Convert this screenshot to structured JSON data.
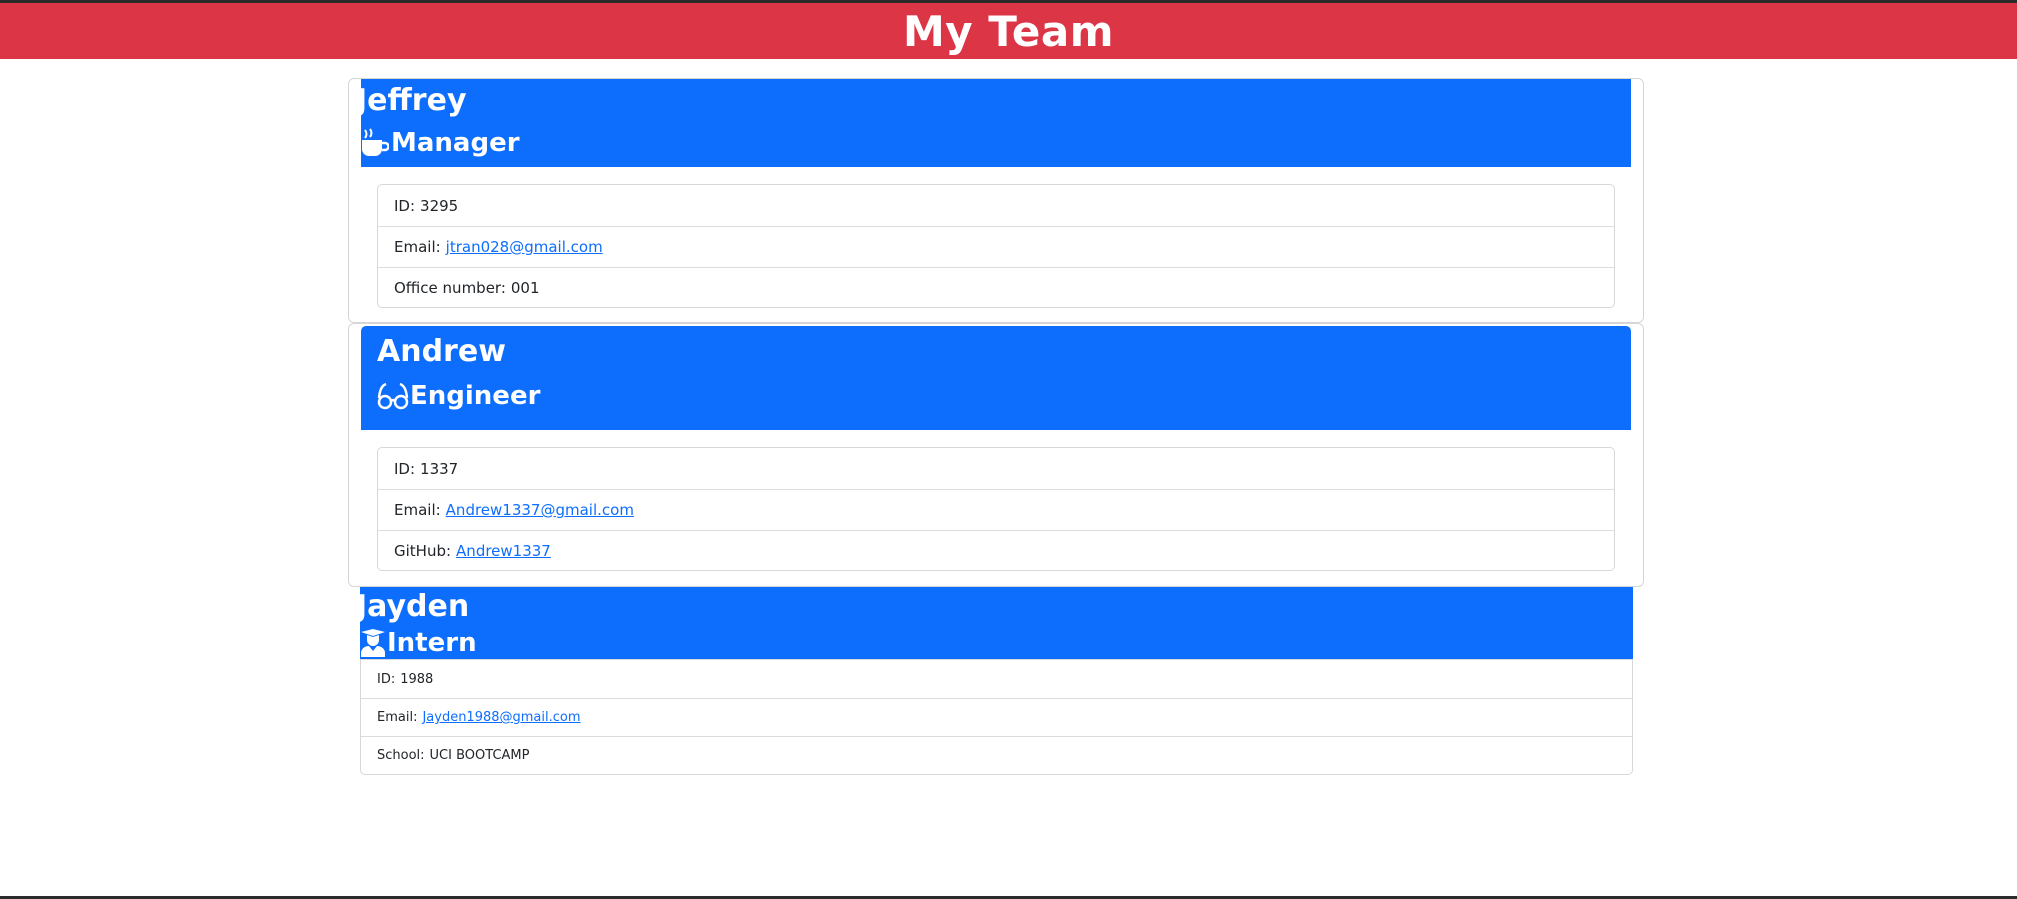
{
  "header": {
    "title": "My Team"
  },
  "team": [
    {
      "name": "Jeffrey",
      "role": "Manager",
      "role_icon": "mug-icon",
      "id_label": "ID:",
      "id": "3295",
      "email_label": "Email:",
      "email": "jtran028@gmail.com",
      "extra_label": "Office number:",
      "extra_value": "001"
    },
    {
      "name": "Andrew",
      "role": "Engineer",
      "role_icon": "glasses-icon",
      "id_label": "ID:",
      "id": "1337",
      "email_label": "Email:",
      "email": "Andrew1337@gmail.com",
      "extra_label": "GitHub:",
      "extra_value": "Andrew1337"
    },
    {
      "name": "Jayden",
      "role": "Intern",
      "role_icon": "graduate-icon",
      "id_label": "ID:",
      "id": "1988",
      "email_label": "Email:",
      "email": "Jayden1988@gmail.com",
      "extra_label": "School:",
      "extra_value": "UCI BOOTCAMP"
    }
  ],
  "colors": {
    "banner": "#dc3545",
    "card_header": "#0d6efd",
    "link": "#0d6efd"
  }
}
